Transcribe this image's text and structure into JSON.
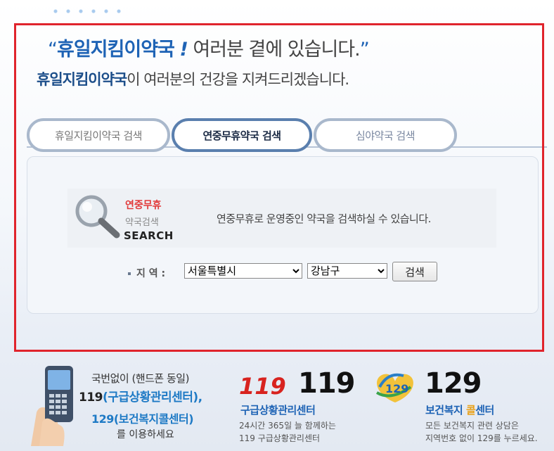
{
  "headline": {
    "open_quote": "“",
    "brand": "휴일지킴이약국",
    "exclaim": "!",
    "rest": " 여러분 곁에 있습니다.",
    "close_quote": "”"
  },
  "subline": {
    "brand": "휴일지킴이약국",
    "rest": "이 여러분의 건강을 지켜드리겠습니다."
  },
  "tabs": [
    {
      "label": "휴일지킴이약국 검색",
      "active": false
    },
    {
      "label": "연중무휴약국 검색",
      "active": true
    },
    {
      "label": "심야약국 검색",
      "active": false
    }
  ],
  "search_box": {
    "title_red": "연중무휴",
    "title_gray": "약국검색",
    "title_en": "SEARCH",
    "description": "연중무휴로 운영중인 약국을 검색하실 수 있습니다.",
    "region_label": "지 역 :",
    "city_selected": "서울특별시",
    "district_selected": "강남구",
    "search_button": "검색"
  },
  "banner": {
    "phone_line1": "국번없이 (핸드폰 동일)",
    "phone_line2_num": "119",
    "phone_line2_text": "(구급상황관리센터),",
    "phone_line3": "129(보건복지콜센터)",
    "phone_line4": "를 이용하세요",
    "ems_logo": "119",
    "ems_number": "119",
    "ems_title": "구급상황관리센터",
    "ems_desc1": "24시간 365일 늘 함께하는",
    "ems_desc2": "119 구급상황관리센터",
    "welfare_logo": "129",
    "welfare_number": "129",
    "welfare_title_a": "보건복지 ",
    "welfare_title_b": "콜",
    "welfare_title_c": "센터",
    "welfare_desc1": "모든 보건복지 관련 상담은",
    "welfare_desc2": "지역번호 없이 129를 누르세요."
  },
  "colors": {
    "highlight_frame": "#e0242c",
    "brand_blue": "#1e63b5",
    "accent_red": "#e23a3a"
  }
}
